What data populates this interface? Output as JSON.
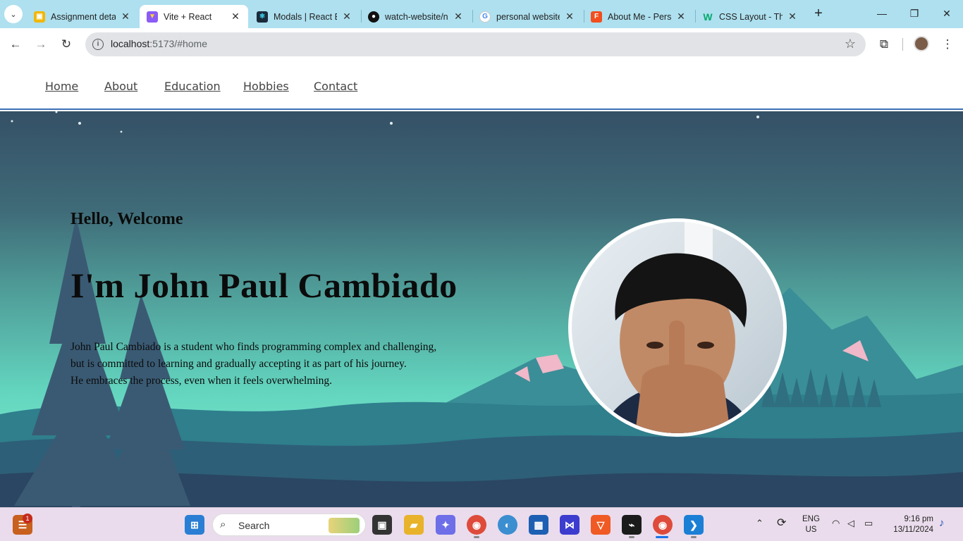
{
  "browser": {
    "tabs": [
      {
        "title": "Assignment deta",
        "favicon": "classroom-icon",
        "color": "#f2b705",
        "active": false
      },
      {
        "title": "Vite + React",
        "favicon": "vite-icon",
        "color": "#8b5cf6",
        "active": true
      },
      {
        "title": "Modals | React B",
        "favicon": "react-bootstrap-icon",
        "color": "#41e0fd",
        "active": false
      },
      {
        "title": "watch-website/n",
        "favicon": "github-icon",
        "color": "#111111",
        "active": false
      },
      {
        "title": "personal website",
        "favicon": "google-icon",
        "color": "#4285f4",
        "active": false
      },
      {
        "title": "About Me - Pers",
        "favicon": "figma-icon",
        "color": "#f24e1e",
        "active": false
      },
      {
        "title": "CSS Layout - The",
        "favicon": "w3schools-icon",
        "color": "#04aa6d",
        "active": false
      }
    ],
    "address": {
      "host": "localhost",
      "path": ":5173/#home"
    }
  },
  "site": {
    "nav": [
      "Home",
      "About",
      "Education",
      "Hobbies",
      "Contact"
    ],
    "hero": {
      "greeting": "Hello, Welcome",
      "heading": "I'm John Paul Cambiado",
      "bio_lines": [
        "John Paul Cambiado is a student who finds programming complex and challenging,",
        "but is committed to learning and gradually accepting it as part of his journey.",
        "He embraces the process, even when it feels overwhelming."
      ]
    }
  },
  "taskbar": {
    "search_placeholder": "Search",
    "widget_badge": "1",
    "language": {
      "line1": "ENG",
      "line2": "US"
    },
    "clock": {
      "time": "9:16 pm",
      "date": "13/11/2024"
    }
  }
}
